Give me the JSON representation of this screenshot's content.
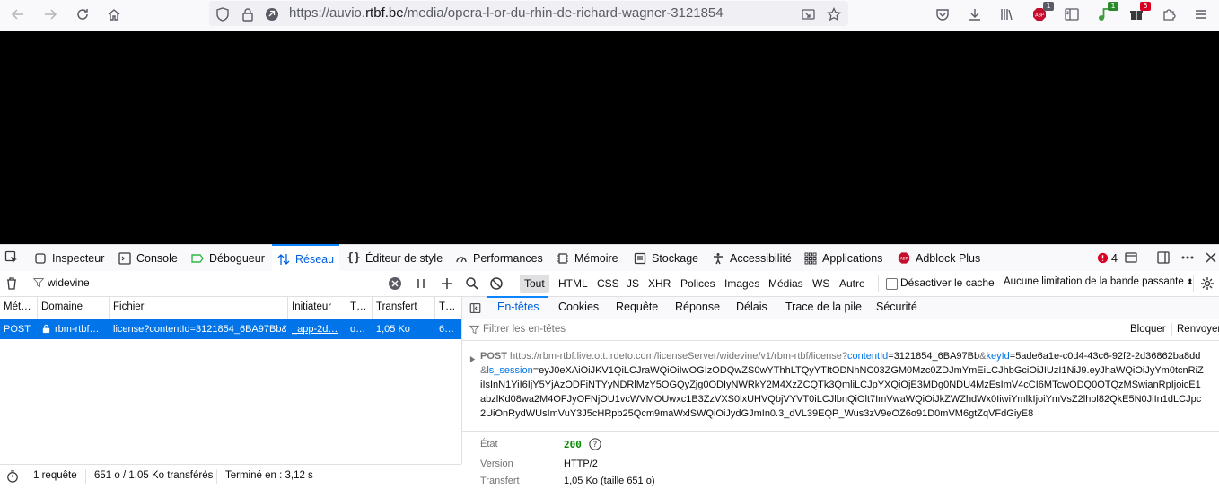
{
  "browser": {
    "url_prefix": "https://auvio.",
    "url_domain": "rtbf.be",
    "url_path": "/media/opera-l-or-du-rhin-de-richard-wagner-3121854",
    "badges": {
      "abp": "1",
      "ext1": "1",
      "ext2": "5"
    },
    "abp_label": "ABP"
  },
  "devtools": {
    "tabs": [
      {
        "label": "Inspecteur"
      },
      {
        "label": "Console"
      },
      {
        "label": "Débogueur"
      },
      {
        "label": "Réseau"
      },
      {
        "label": "Éditeur de style"
      },
      {
        "label": "Performances"
      },
      {
        "label": "Mémoire"
      },
      {
        "label": "Stockage"
      },
      {
        "label": "Accessibilité"
      },
      {
        "label": "Applications"
      },
      {
        "label": "Adblock Plus"
      }
    ],
    "error_count": "4",
    "filter": {
      "value": "widevine",
      "types": [
        "Tout",
        "HTML",
        "CSS",
        "JS",
        "XHR",
        "Polices",
        "Images",
        "Médias",
        "WS",
        "Autre"
      ],
      "selected_type": "Tout",
      "disable_cache": "Désactiver le cache",
      "throttle": "Aucune limitation de la bande passante"
    },
    "table": {
      "headers": [
        "Mét…",
        "Domaine",
        "Fichier",
        "Initiateur",
        "T…",
        "Transfert",
        "T…"
      ],
      "row": {
        "method": "POST",
        "domain": "rbm-rtbf…",
        "file": "license?contentId=3121854_6BA97Bb&l",
        "initiator": "_app-2d…",
        "type": "o…",
        "transfer": "1,05 Ko",
        "size": "6…"
      }
    },
    "status": {
      "requests": "1 requête",
      "transferred": "651 o / 1,05 Ko transférés",
      "finished": "Terminé en : 3,12 s"
    },
    "side_tabs": [
      "En-têtes",
      "Cookies",
      "Requête",
      "Réponse",
      "Délais",
      "Trace de la pile",
      "Sécurité"
    ],
    "side_filter_placeholder": "Filtrer les en-têtes",
    "block_label": "Bloquer",
    "resend_label": "Renvoyer",
    "request": {
      "method": "POST",
      "base": "https://rbm-rtbf.live.ott.irdeto.com/licenseServer/widevine/v1/rbm-rtbf/license",
      "q1": "?",
      "k1": "contentId",
      "v1": "=3121854_6BA97Bb",
      "q2": "&",
      "k2": "keyId",
      "v2": "=5ade6a1e-c0d4-43c6-92f2-2d36862ba8dd",
      "q3": "&",
      "k3": "ls_session",
      "v3": "=eyJ0eXAiOiJKV1QiLCJraWQiOiIwOGIzODQwZS0wYThhLTQyYTItODNhNC03ZGM0Mzc0ZDJmYmEiLCJhbGciOiJIUzI1NiJ9.eyJhaWQiOiJyYm0tcnRiZiIsInN1YiI6IjY5YjAzODFiNTYyNDRlMzY5OGQyZjg0ODIyNWRkY2M4XzZCQTk3QmliLCJpYXQiOjE3MDg0NDU4MzEsImV4cCI6MTcwODQ0OTQzMSwianRpIjoicE1abzlKd08wa2M4OFJyOFNjOU1vcWVMOUwxc1B3ZzVXS0lxUHVQbjVYVT0iLCJlbnQiOlt7ImVwaWQiOiJkZWZhdWx0IiwiYmlkIjoiYmVsZ2lhbl82QkE5N0JiIn1dLCJpc2UiOnRydWUsImVuY3J5cHRpb25Qcm9maWxlSWQiOiJydGJmIn0.3_dVL39EQP_Wus3zV9eOZ6o91D0mVM6gtZqVFdGiyE8"
    },
    "details": {
      "state_label": "État",
      "state_value": "200",
      "version_label": "Version",
      "version_value": "HTTP/2",
      "transfer_label": "Transfert",
      "transfer_value": "1,05 Ko (taille 651 o)"
    }
  }
}
